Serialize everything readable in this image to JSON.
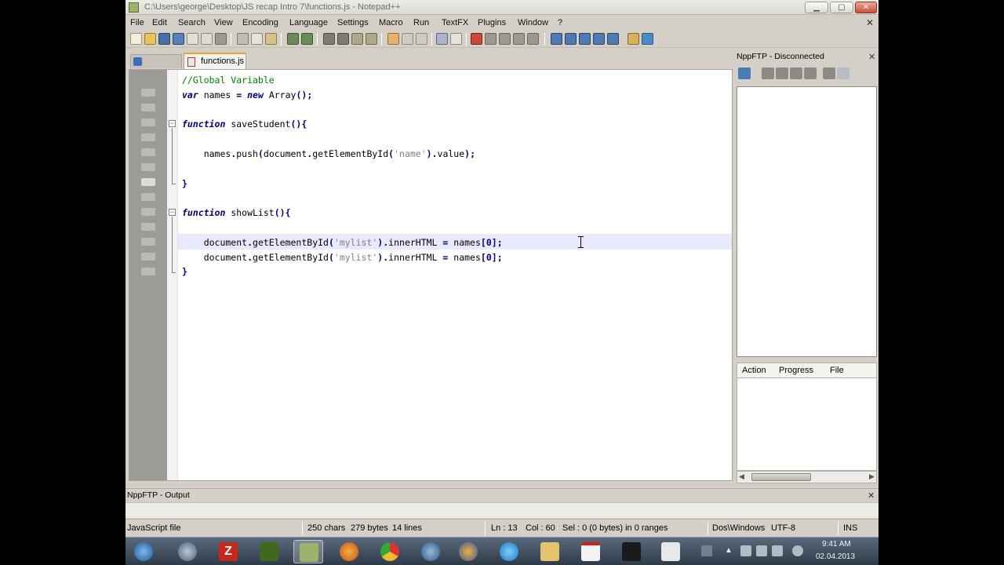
{
  "window": {
    "title": "C:\\Users\\george\\Desktop\\JS recap Intro 7\\functions.js - Notepad++"
  },
  "menu": [
    "File",
    "Edit",
    "Search",
    "View",
    "Encoding",
    "Language",
    "Settings",
    "Macro",
    "Run",
    "TextFX",
    "Plugins",
    "Window",
    "?"
  ],
  "tabs": [
    {
      "label": "",
      "active": false
    },
    {
      "label": "functions.js",
      "active": true
    }
  ],
  "editor": {
    "language": "JavaScript",
    "lines": [
      {
        "indent": "",
        "text": "//Global Variable"
      },
      {
        "indent": "",
        "text": "var names = new Array();"
      },
      {
        "indent": "",
        "text": ""
      },
      {
        "indent": "",
        "text": "function saveStudent(){"
      },
      {
        "indent": "",
        "text": ""
      },
      {
        "indent": "    ",
        "text": "names.push(document.getElementById('name').value);"
      },
      {
        "indent": "",
        "text": ""
      },
      {
        "indent": "",
        "text": "}"
      },
      {
        "indent": "",
        "text": ""
      },
      {
        "indent": "",
        "text": "function showList(){"
      },
      {
        "indent": "",
        "text": ""
      },
      {
        "indent": "    ",
        "text": "document.getElementById('mylist').innerHTML = names[0];"
      },
      {
        "indent": "    ",
        "text": "document.getElementById('mylist').innerHTML = names[0];"
      },
      {
        "indent": "",
        "text": "}"
      }
    ],
    "current_line": 12,
    "colors": {
      "comment": "#008000",
      "keyword": "#00007f",
      "string": "#808080",
      "current_line_bg": "#e8e8ff",
      "gutter": "#9c9b98"
    }
  },
  "ftp": {
    "title": "NppFTP - Disconnected",
    "queue_columns": [
      "Action",
      "Progress",
      "File"
    ]
  },
  "output": {
    "title": "NppFTP - Output"
  },
  "status": {
    "file_type": "JavaScript file",
    "chars": "250 chars",
    "bytes": "279 bytes",
    "lines": "14 lines",
    "ln": "Ln : 13",
    "col": "Col : 60",
    "sel": "Sel : 0 (0 bytes) in 0 ranges",
    "eol": "Dos\\Windows",
    "encoding": "UTF-8",
    "mode": "INS"
  },
  "taskbar": {
    "time": "9:41 AM",
    "date": "02.04.2013",
    "apps": [
      "start-orb",
      "network",
      "filezilla",
      "terminal",
      "notepad-plus-plus",
      "firefox",
      "chrome",
      "thunderbird",
      "firefox-alt",
      "internet-explorer",
      "file-explorer",
      "acrobat",
      "vlc",
      "window-manager"
    ]
  }
}
